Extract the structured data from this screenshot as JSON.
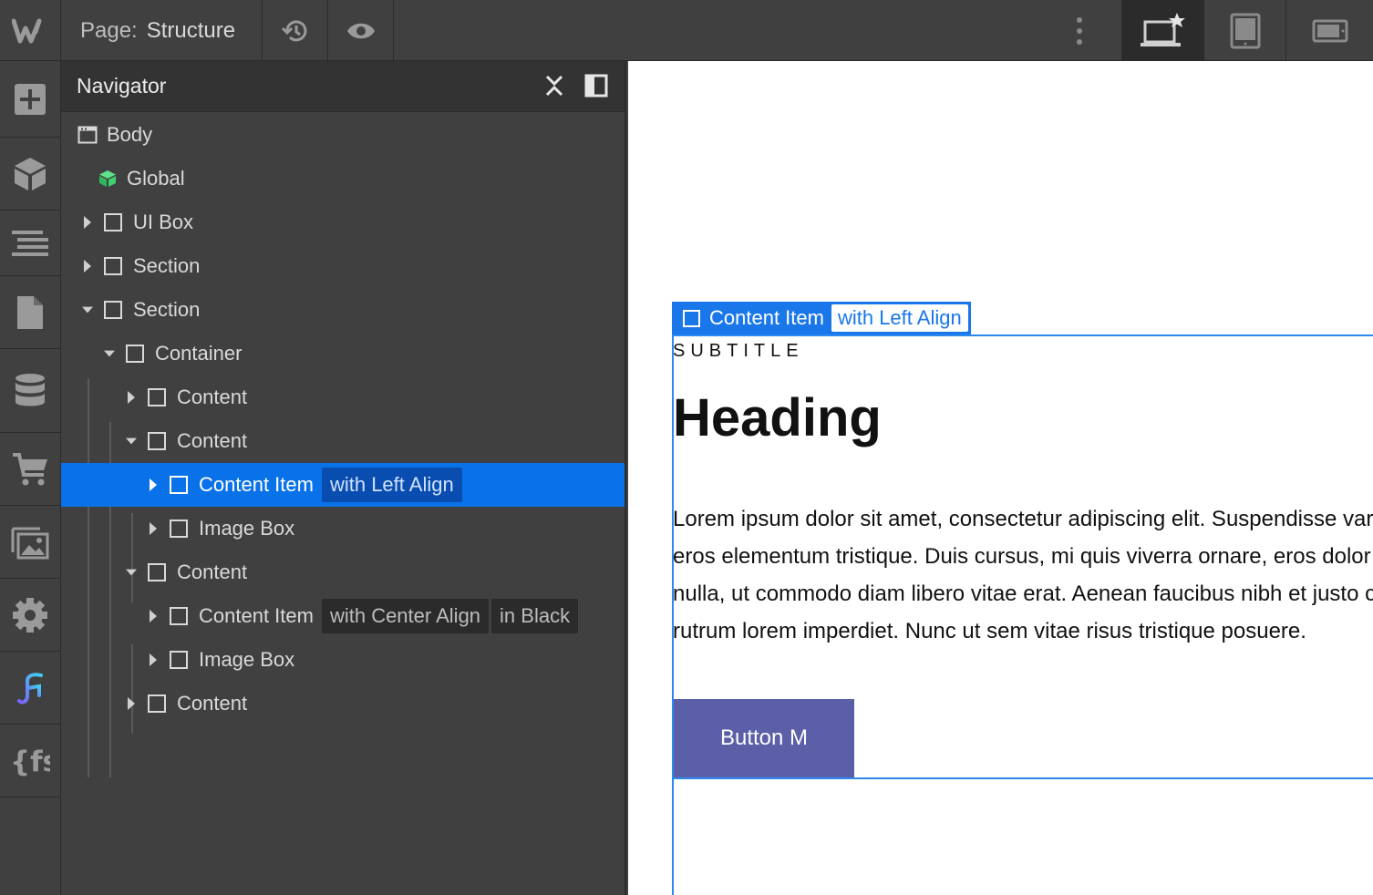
{
  "topbar": {
    "page_prefix": "Page:",
    "page_name": "Structure",
    "icons": [
      "webflow-logo-icon",
      "history-icon",
      "preview-eye-icon",
      "more-vertical-icon",
      "desktop-star-icon",
      "tablet-icon",
      "mobile-landscape-icon"
    ]
  },
  "rail": {
    "icons": [
      "add-icon",
      "symbols-cube-icon",
      "navigator-icon",
      "pages-icon",
      "cms-database-icon",
      "ecommerce-cart-icon",
      "assets-image-icon",
      "settings-gear-icon",
      "finsweet-attributes-icon",
      "fs-code-icon"
    ]
  },
  "navigator": {
    "title": "Navigator",
    "items": [
      {
        "label": "Body",
        "tags": [],
        "icon": "body-icon"
      },
      {
        "label": "Global",
        "tags": [],
        "icon": "symbol-icon",
        "icon_color": "#3fcf6c"
      },
      {
        "label": "UI Box",
        "tags": [],
        "icon": "element-icon"
      },
      {
        "label": "Section",
        "tags": [],
        "icon": "element-icon"
      },
      {
        "label": "Section",
        "tags": [],
        "icon": "element-icon"
      },
      {
        "label": "Container",
        "tags": [],
        "icon": "element-icon"
      },
      {
        "label": "Content",
        "tags": [],
        "icon": "element-icon"
      },
      {
        "label": "Content",
        "tags": [],
        "icon": "element-icon"
      },
      {
        "label": "Content Item",
        "tags": [
          "with Left Align"
        ],
        "icon": "element-icon",
        "selected": true
      },
      {
        "label": "Image Box",
        "tags": [],
        "icon": "element-icon"
      },
      {
        "label": "Content",
        "tags": [],
        "icon": "element-icon"
      },
      {
        "label": "Content Item",
        "tags": [
          "with Center Align",
          "in Black"
        ],
        "icon": "element-icon"
      },
      {
        "label": "Image Box",
        "tags": [],
        "icon": "element-icon"
      },
      {
        "label": "Content",
        "tags": [],
        "icon": "element-icon"
      }
    ]
  },
  "canvas": {
    "selected_tag": {
      "label": "Content Item",
      "combo": "with Left Align"
    },
    "subtitle": "SUBTITLE",
    "heading": "Heading",
    "paragraph_lines": [
      "Lorem ipsum dolor sit amet, consectetur adipiscing elit. Suspendisse varius enim in",
      "eros elementum tristique. Duis cursus, mi quis viverra ornare, eros dolor interdum",
      "nulla, ut commodo diam libero vitae erat. Aenean faucibus nibh et justo cursus id",
      "rutrum lorem imperdiet. Nunc ut sem vitae risus tristique posuere."
    ],
    "button_label": "Button M"
  },
  "colors": {
    "selection_blue": "#0a72e9",
    "canvas_outline": "#2d88f0",
    "button_bg": "#5a5fa8",
    "panel_bg": "#404040"
  }
}
